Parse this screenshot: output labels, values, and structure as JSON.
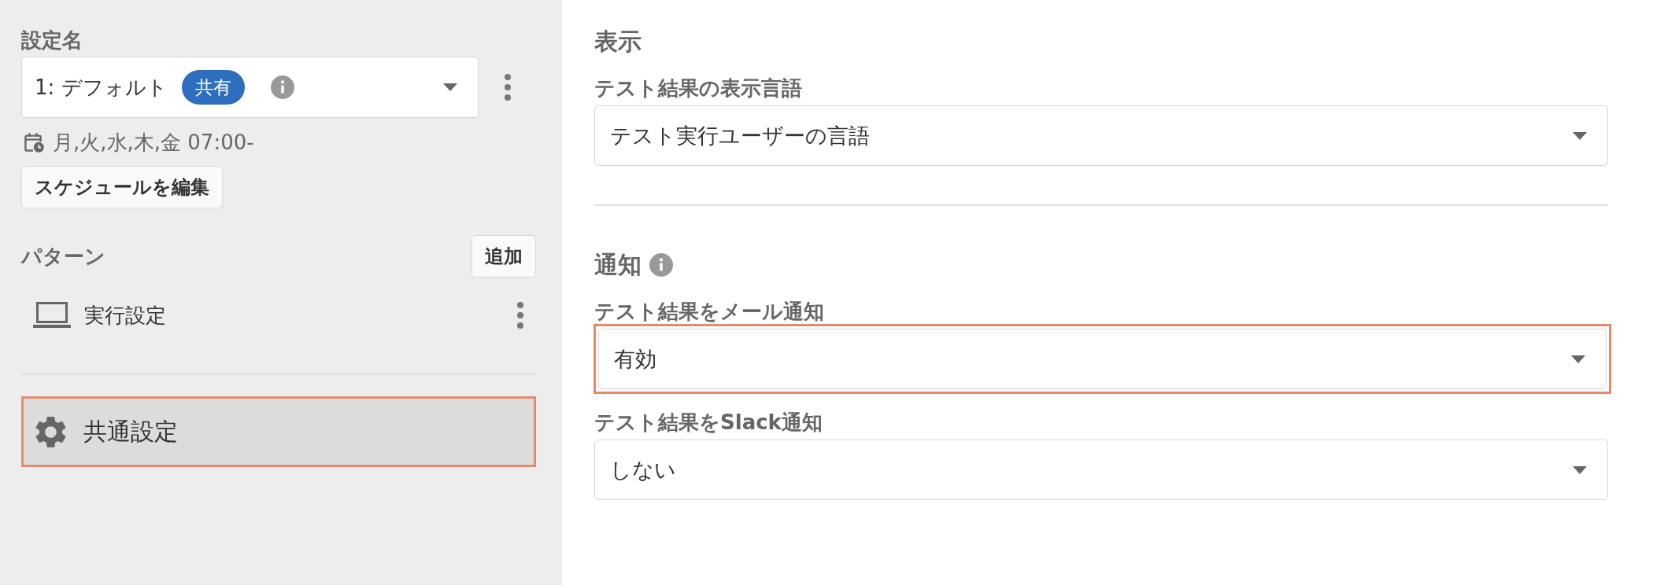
{
  "sidebar": {
    "setting_name": {
      "label": "設定名",
      "value": "1: デフォルト",
      "badge": "共有"
    },
    "schedule": {
      "text": "月,火,水,木,金 07:00-",
      "edit_button": "スケジュールを編集"
    },
    "patterns": {
      "title": "パターン",
      "add_button": "追加",
      "items": [
        {
          "label": "実行設定",
          "selected": false
        }
      ]
    },
    "common_settings": {
      "label": "共通設定",
      "selected": true,
      "highlighted": true
    }
  },
  "main": {
    "sections": [
      {
        "title": "表示",
        "info": false,
        "fields": [
          {
            "label": "テスト結果の表示言語",
            "value": "テスト実行ユーザーの言語",
            "highlighted": false
          }
        ]
      },
      {
        "title": "通知",
        "info": true,
        "fields": [
          {
            "label": "テスト結果をメール通知",
            "value": "有効",
            "highlighted": true
          },
          {
            "label": "テスト結果をSlack通知",
            "value": "しない",
            "highlighted": false
          }
        ]
      }
    ]
  }
}
